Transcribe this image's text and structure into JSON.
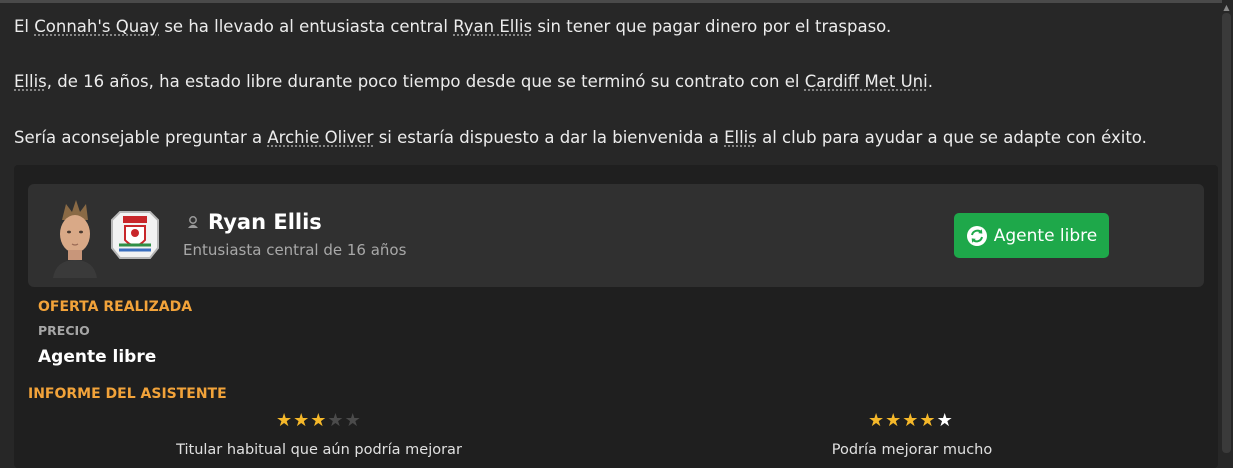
{
  "news": {
    "p1": {
      "t1": "El ",
      "club_link": "Connah's Quay",
      "t2": " se ha llevado al entusiasta central ",
      "player_link": "Ryan Ellis",
      "t3": " sin tener que pagar dinero por el traspaso."
    },
    "p2": {
      "player_link": "Ellis",
      "t1": ", de 16 años, ha estado libre durante poco tiempo desde que se terminó su contrato con el ",
      "club_link": "Cardiff Met Uni",
      "t2": "."
    },
    "p3": {
      "t1": "Sería aconsejable preguntar a ",
      "person_link": "Archie Oliver",
      "t2": " si estaría dispuesto a dar la bienvenida a ",
      "player_link": "Ellis",
      "t3": " al club para ayudar a que se adapte con éxito."
    }
  },
  "player": {
    "name": "Ryan Ellis",
    "subtitle": "Entusiasta central de 16 años",
    "status_button": "Agente libre"
  },
  "offer": {
    "heading": "OFERTA REALIZADA",
    "price_label": "PRECIO",
    "price_value": "Agente libre"
  },
  "assistant": {
    "heading": "INFORME DEL ASISTENTE",
    "current": {
      "stars": 3,
      "max": 5,
      "caption": "Titular habitual que aún podría mejorar"
    },
    "potential": {
      "stars": 4.5,
      "max": 5,
      "caption": "Podría mejorar mucho"
    }
  },
  "colors": {
    "accent_orange": "#f2a33a",
    "button_green": "#1ea84a",
    "star_gold": "#f5b82a"
  }
}
